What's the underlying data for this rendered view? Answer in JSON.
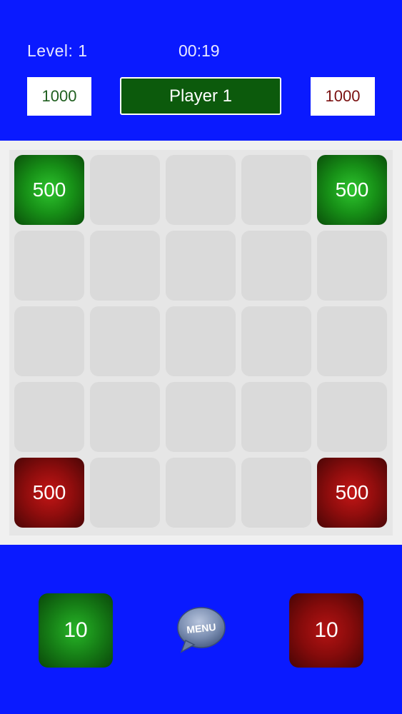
{
  "header": {
    "level_label": "Level: 1",
    "timer": "00:19",
    "score_left": "1000",
    "score_right": "1000",
    "current_player": "Player 1",
    "score_left_color": "#1f5f1f",
    "score_right_color": "#7a1010"
  },
  "board": {
    "rows": 5,
    "cols": 5,
    "tiles": [
      {
        "value": "500",
        "owner": "green",
        "row": 0,
        "col": 0
      },
      {
        "value": "500",
        "owner": "green",
        "row": 0,
        "col": 4
      },
      {
        "value": "500",
        "owner": "red",
        "row": 4,
        "col": 0
      },
      {
        "value": "500",
        "owner": "red",
        "row": 4,
        "col": 4
      }
    ]
  },
  "footer": {
    "green_tile_value": "10",
    "red_tile_value": "10",
    "menu_label": "MENU"
  },
  "colors": {
    "background": "#0a1aff",
    "green": "#179017",
    "red": "#8f0d0d",
    "player_box": "#0c5a0c"
  }
}
